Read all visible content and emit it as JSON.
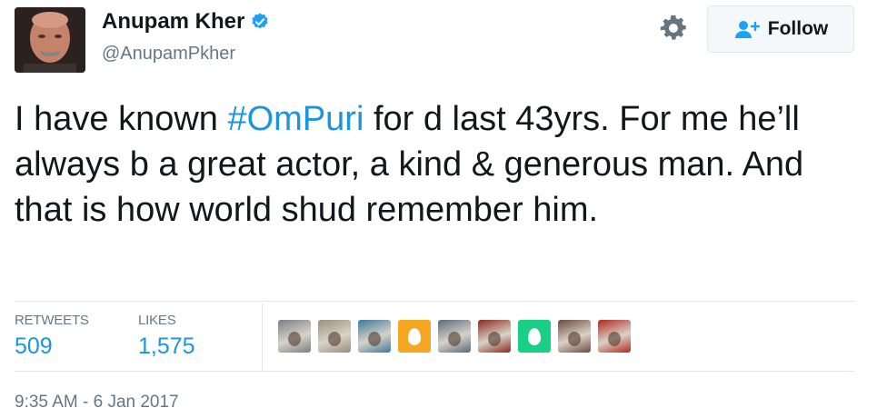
{
  "user": {
    "display_name": "Anupam Kher",
    "handle": "@AnupamPkher",
    "verified": true
  },
  "actions": {
    "settings_icon": "gear-icon",
    "follow_label": "Follow"
  },
  "tweet": {
    "text_before": "I have known ",
    "hashtag": "#OmPuri",
    "text_after": " for d last 43yrs. For me he’ll always b a great actor, a kind & generous man. And that is how world shud remember him."
  },
  "stats": {
    "retweets_label": "RETWEETS",
    "retweets_value": "509",
    "likes_label": "LIKES",
    "likes_value": "1,575"
  },
  "likers": [
    {
      "type": "photo",
      "color": "#7a7f86"
    },
    {
      "type": "photo",
      "color": "#9a8f7e"
    },
    {
      "type": "photo",
      "color": "#3d7a9c"
    },
    {
      "type": "egg",
      "color": "#f5a623"
    },
    {
      "type": "photo",
      "color": "#5a6a7c"
    },
    {
      "type": "photo",
      "color": "#8c2a1e"
    },
    {
      "type": "egg",
      "color": "#19cf86"
    },
    {
      "type": "photo",
      "color": "#6e4a3c"
    },
    {
      "type": "photo",
      "color": "#b4281e"
    }
  ],
  "timestamp": "9:35 AM - 6 Jan 2017",
  "colors": {
    "link": "#1b95e0",
    "secondary_text": "#657786",
    "verified_badge": "#1da1f2"
  }
}
